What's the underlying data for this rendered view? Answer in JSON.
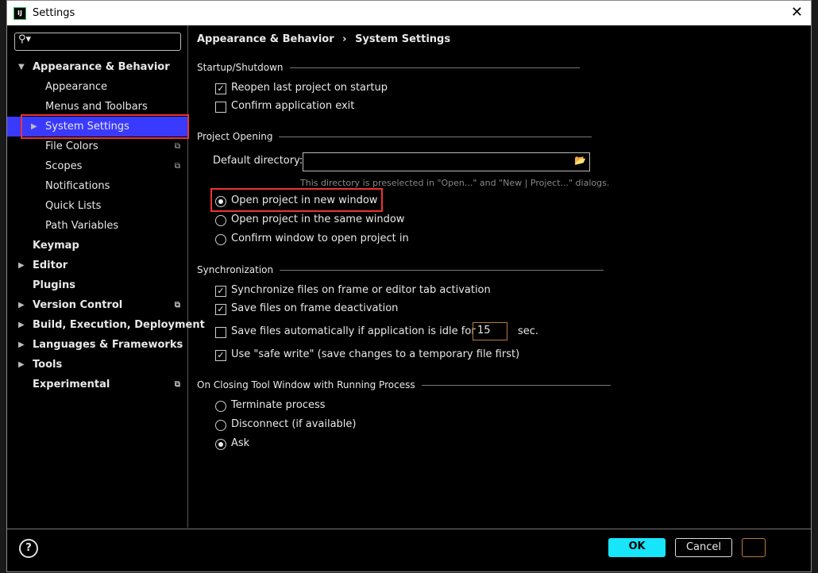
{
  "window": {
    "title": "Settings",
    "logo": "IJ"
  },
  "search": {
    "placeholder": ""
  },
  "tree": [
    {
      "label": "Appearance & Behavior",
      "bold": true,
      "expanded": true
    },
    {
      "label": "Appearance"
    },
    {
      "label": "Menus and Toolbars"
    },
    {
      "label": "System Settings",
      "selected": true
    },
    {
      "label": "File Colors",
      "copy": true
    },
    {
      "label": "Scopes",
      "copy": true
    },
    {
      "label": "Notifications"
    },
    {
      "label": "Quick Lists"
    },
    {
      "label": "Path Variables"
    },
    {
      "label": "Keymap",
      "bold": true
    },
    {
      "label": "Editor",
      "bold": true,
      "collapsed": true
    },
    {
      "label": "Plugins",
      "bold": true
    },
    {
      "label": "Version Control",
      "bold": true,
      "collapsed": true,
      "copy": true
    },
    {
      "label": "Build, Execution, Deployment",
      "bold": true,
      "collapsed": true
    },
    {
      "label": "Languages & Frameworks",
      "bold": true,
      "collapsed": true
    },
    {
      "label": "Tools",
      "bold": true,
      "collapsed": true
    },
    {
      "label": "Experimental",
      "bold": true,
      "copy": true
    }
  ],
  "breadcrumb": {
    "parent": "Appearance & Behavior",
    "sep": "›",
    "current": "System Settings"
  },
  "startup": {
    "title": "Startup/Shutdown",
    "reopen": "Reopen last project on startup",
    "reopen_checked": true,
    "confirm": "Confirm application exit",
    "confirm_checked": false
  },
  "opening": {
    "title": "Project Opening",
    "dir_label": "Default directory:",
    "dir_value": "",
    "hint": "This directory is preselected in \"Open...\" and \"New | Project...\" dialogs.",
    "options": [
      "Open project in new window",
      "Open project in the same window",
      "Confirm window to open project in"
    ],
    "selected": 0
  },
  "sync": {
    "title": "Synchronization",
    "frame": "Synchronize files on frame or editor tab activation",
    "deact": "Save files on frame deactivation",
    "idle": "Save files automatically if application is idle for",
    "idle_value": "15",
    "idle_unit": "sec.",
    "safe": "Use \"safe write\" (save changes to a temporary file first)",
    "checked": [
      true,
      true,
      false,
      true
    ]
  },
  "closing": {
    "title": "On Closing Tool Window with Running Process",
    "options": [
      "Terminate process",
      "Disconnect (if available)",
      "Ask"
    ],
    "selected": 2
  },
  "buttons": {
    "help": "?",
    "ok": "OK",
    "cancel": "Cancel"
  },
  "colors": {
    "selection": "#3a3aff",
    "ok": "#17e5fa",
    "highlight": "#e33333"
  }
}
